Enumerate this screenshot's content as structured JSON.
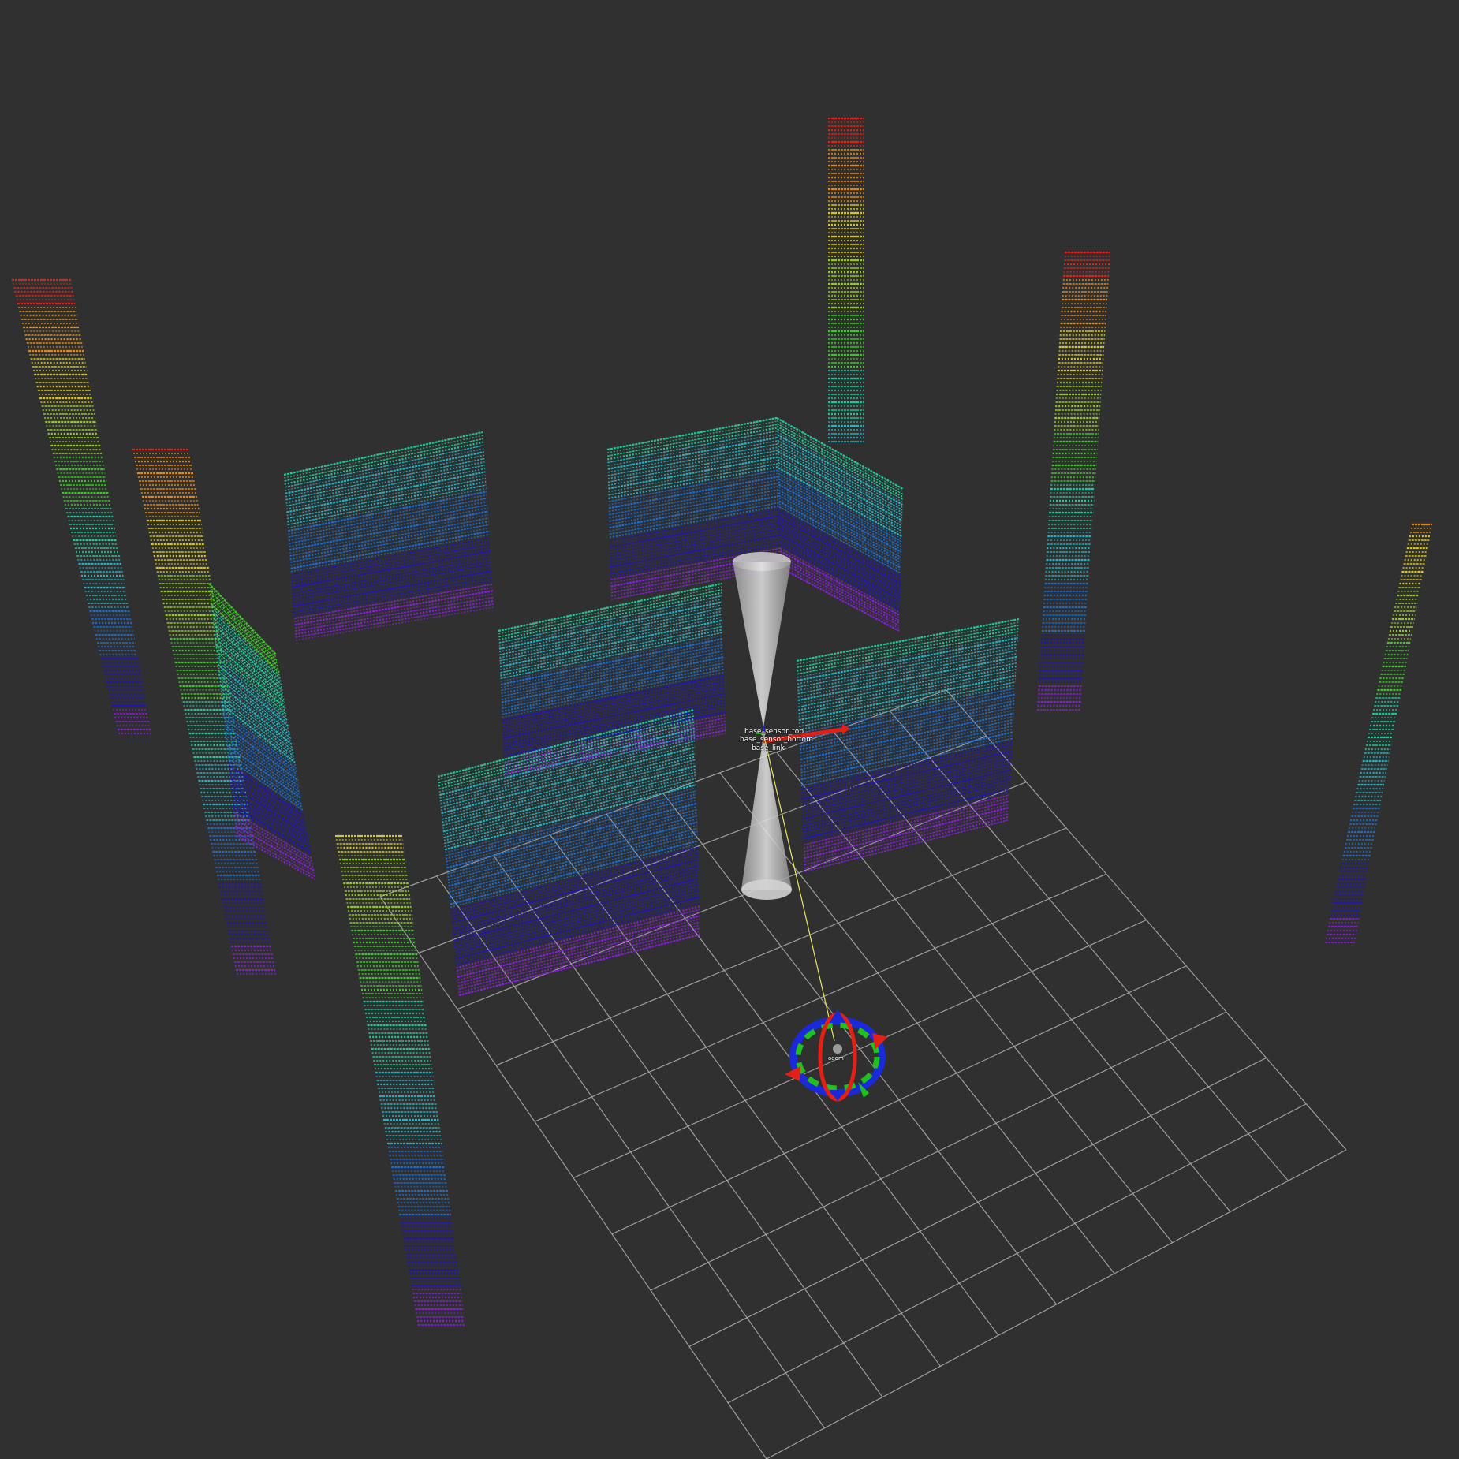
{
  "viewer": {
    "background": "#303030",
    "grid_color": "#a6a6a6",
    "point_colormap": [
      "#8a1fe0",
      "#1f12c8",
      "#1a6fd8",
      "#22b8c8",
      "#20d0a0",
      "#3fcf2a",
      "#9bd51c",
      "#e0d01a",
      "#e8901a",
      "#e3261a"
    ]
  },
  "tf_frames": [
    {
      "id": "sensor-top",
      "label": "base_sensor_top"
    },
    {
      "id": "sensor-bottom",
      "label": "base_sensor_bottom"
    },
    {
      "id": "base-link",
      "label": "base_link"
    },
    {
      "id": "goal-marker",
      "label": "odom"
    }
  ],
  "axis_colors": {
    "x": "#e22015",
    "y": "#1fc01f",
    "z": "#1a2ad8"
  },
  "cone_color": "#d8d8d8",
  "link_line_color": "#e8e860"
}
